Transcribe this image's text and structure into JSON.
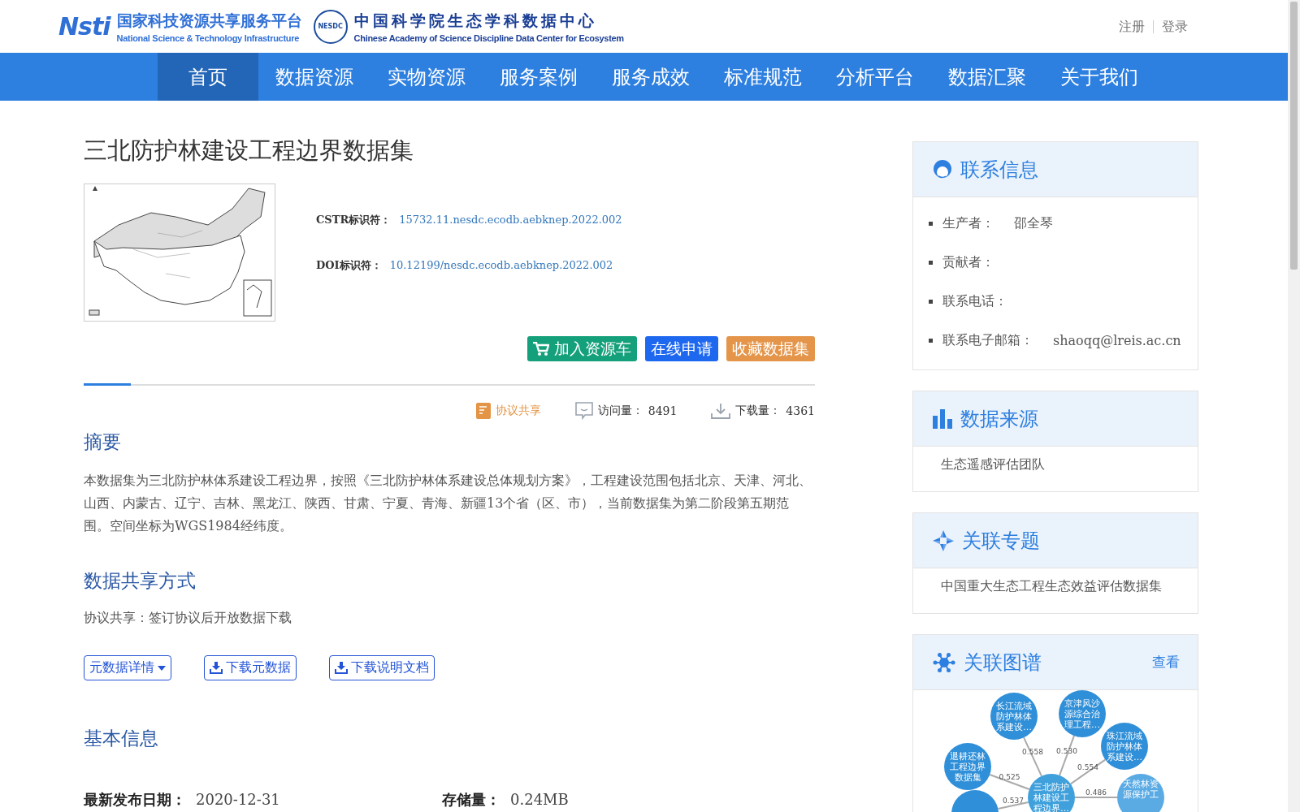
{
  "header": {
    "logo_left": {
      "mark": "Nsti",
      "title": "国家科技资源共享服务平台",
      "subtitle": "National Science & Technology Infrastructure"
    },
    "logo_right": {
      "mark": "NESDC",
      "title": "中国科学院生态学科数据中心",
      "subtitle": "Chinese Academy of Science Discipline Data Center for Ecosystem"
    },
    "auth_links": [
      "注册",
      "登录"
    ]
  },
  "nav": [
    {
      "label": "首页",
      "selected": true
    },
    {
      "label": "数据资源",
      "selected": false
    },
    {
      "label": "实物资源",
      "selected": false
    },
    {
      "label": "服务案例",
      "selected": false
    },
    {
      "label": "服务成效",
      "selected": false
    },
    {
      "label": "标准规范",
      "selected": false
    },
    {
      "label": "分析平台",
      "selected": false
    },
    {
      "label": "数据汇聚",
      "selected": false
    },
    {
      "label": "关于我们",
      "selected": false
    }
  ],
  "dataset": {
    "title": "三北防护林建设工程边界数据集",
    "identifiers": [
      {
        "label": "CSTR标识符：",
        "value": "15732.11.nesdc.ecodb.aebknep.2022.002"
      },
      {
        "label": "DOI标识符：",
        "value": "10.12199/nesdc.ecodb.aebknep.2022.002"
      }
    ],
    "actions": [
      {
        "kind": "cart",
        "label": "加入资源车"
      },
      {
        "kind": "apply",
        "label": "在线申请"
      },
      {
        "kind": "favorite",
        "label": "收藏数据集"
      }
    ],
    "stats": [
      {
        "kind": "share",
        "label": "协议共享"
      },
      {
        "kind": "views",
        "label": "访问量：",
        "value": "8491"
      },
      {
        "kind": "downloads",
        "label": "下载量：",
        "value": "4361"
      }
    ],
    "abstract": {
      "heading": "摘要",
      "text": "本数据集为三北防护林体系建设工程边界，按照《三北防护林体系建设总体规划方案》，工程建设范围包括北京、天津、河北、山西、内蒙古、辽宁、吉林、黑龙江、陕西、甘肃、宁夏、青海、新疆13个省（区、市），当前数据集为第二阶段第五期范围。空间坐标为WGS1984经纬度。"
    },
    "sharing": {
      "heading": "数据共享方式",
      "text": "协议共享：签订协议后开放数据下载"
    },
    "tools": [
      {
        "kind": "dropdown",
        "label": "元数据详情"
      },
      {
        "kind": "download",
        "label": "下载元数据"
      },
      {
        "kind": "download",
        "label": "下载说明文档"
      }
    ],
    "basic_info": {
      "heading": "基本信息",
      "fields": [
        {
          "label": "最新发布日期：",
          "value": "2020-12-31"
        },
        {
          "label": "存储量：",
          "value": "0.24MB"
        }
      ]
    }
  },
  "sidebar": {
    "contact": {
      "title": "联系信息",
      "items": [
        {
          "label": "生产者：",
          "value": "邵全琴"
        },
        {
          "label": "贡献者："
        },
        {
          "label": "联系电话："
        },
        {
          "label": "联系电子邮箱：",
          "value": "shaoqq@lreis.ac.cn"
        }
      ]
    },
    "source": {
      "title": "数据来源",
      "items": [
        "生态遥感评估团队"
      ]
    },
    "topics": {
      "title": "关联专题",
      "items": [
        "中国重大生态工程生态效益评估数据集"
      ]
    },
    "graph": {
      "title": "关联图谱",
      "link": "查看",
      "center": "三北防护林建设工程边界…",
      "nodes": [
        {
          "label": "长江流域防护林体系建设…",
          "weight": "0.558"
        },
        {
          "label": "京津风沙源综合治理工程…",
          "weight": "0.530"
        },
        {
          "label": "珠江流域防护林体系建设…",
          "weight": "0.554"
        },
        {
          "label": "退耕还林工程边界数据集",
          "weight": "0.525"
        },
        {
          "weight": "0.537"
        },
        {
          "label": "天然林资源保护工",
          "weight": "0.486"
        }
      ]
    }
  }
}
